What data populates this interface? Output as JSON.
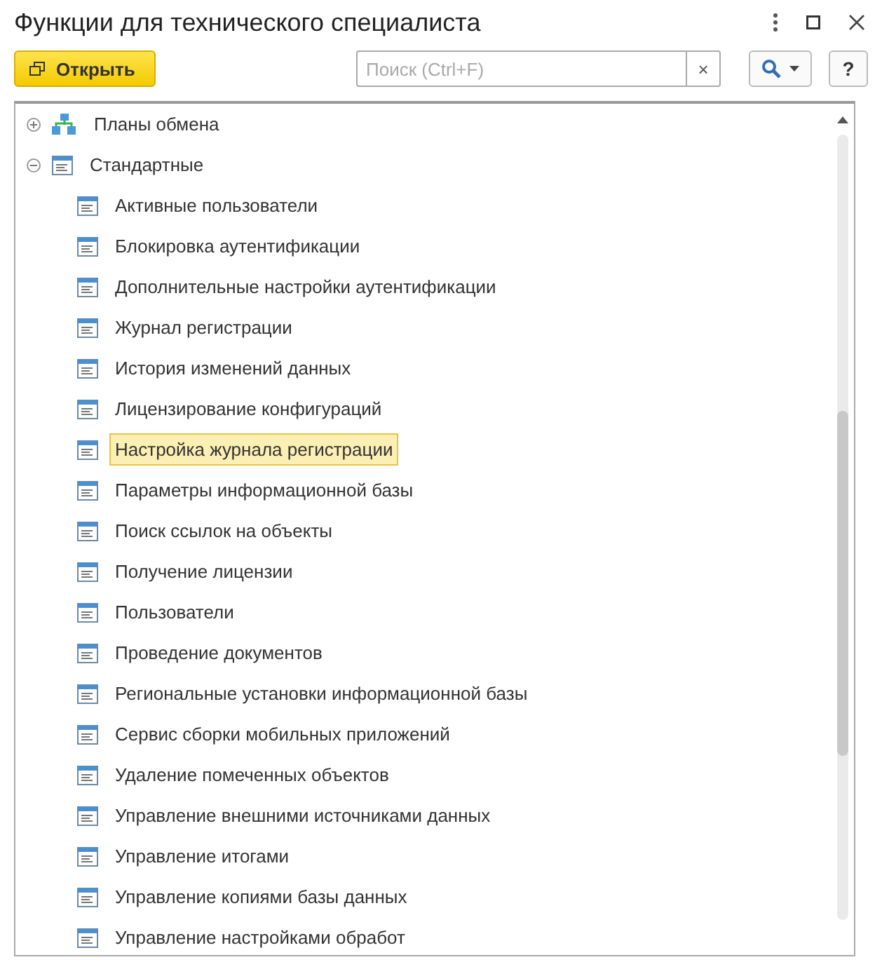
{
  "window": {
    "title": "Функции для технического специалиста"
  },
  "toolbar": {
    "open_button": "Открыть",
    "search": {
      "placeholder": "Поиск (Ctrl+F)"
    },
    "clear_button": "×",
    "help_button": "?"
  },
  "tree": [
    {
      "label": "Планы обмена",
      "kind": "exchange",
      "expanded": false,
      "selected": false
    },
    {
      "label": "Стандартные",
      "kind": "group",
      "expanded": true,
      "selected": false,
      "children": [
        {
          "label": "Активные пользователи",
          "selected": false
        },
        {
          "label": "Блокировка аутентификации",
          "selected": false
        },
        {
          "label": "Дополнительные настройки аутентификации",
          "selected": false
        },
        {
          "label": "Журнал регистрации",
          "selected": false
        },
        {
          "label": "История изменений данных",
          "selected": false
        },
        {
          "label": "Лицензирование конфигураций",
          "selected": false
        },
        {
          "label": "Настройка журнала регистрации",
          "selected": true
        },
        {
          "label": "Параметры информационной базы",
          "selected": false
        },
        {
          "label": "Поиск ссылок на объекты",
          "selected": false
        },
        {
          "label": "Получение лицензии",
          "selected": false
        },
        {
          "label": "Пользователи",
          "selected": false
        },
        {
          "label": "Проведение документов",
          "selected": false
        },
        {
          "label": "Региональные установки информационной базы",
          "selected": false
        },
        {
          "label": "Сервис сборки мобильных приложений",
          "selected": false
        },
        {
          "label": "Удаление помеченных объектов",
          "selected": false
        },
        {
          "label": "Управление внешними источниками данных",
          "selected": false
        },
        {
          "label": "Управление итогами",
          "selected": false
        },
        {
          "label": "Управление копиями базы данных",
          "selected": false
        },
        {
          "label": "Управление настройками обработ",
          "selected": false
        }
      ]
    }
  ]
}
